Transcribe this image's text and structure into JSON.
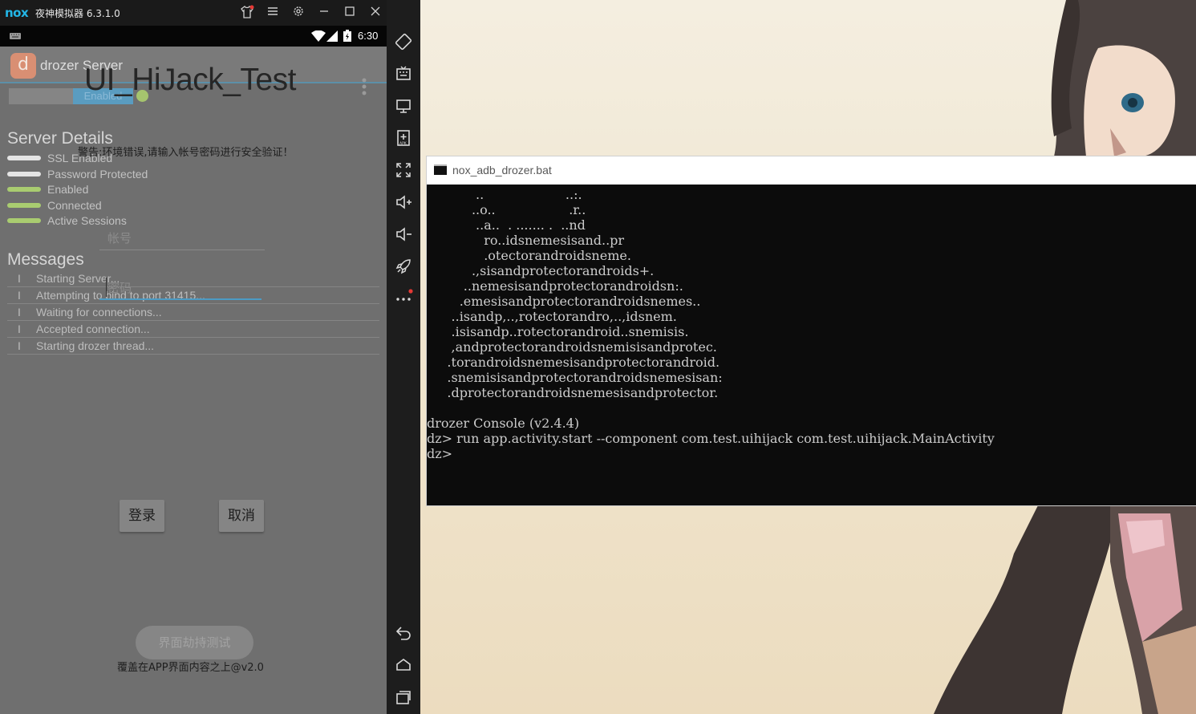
{
  "nox": {
    "logo": "nox",
    "title": "夜神模拟器 6.3.1.0",
    "accent": "#23b6e6"
  },
  "android": {
    "status_time": "6:30",
    "app_name": "drozer Server",
    "app_icon_letter": "d",
    "overlay_title": "UI_HiJack_Test",
    "enable_label": "Enabled",
    "server_details_heading": "Server Details",
    "warning_text": "警告:环境错误,请输入帐号密码进行安全验证！",
    "details": [
      {
        "label": "SSL Enabled",
        "color": "#e4e4e4"
      },
      {
        "label": "Password Protected",
        "color": "#e4e4e4"
      },
      {
        "label": "Enabled",
        "color": "#a9cc70"
      },
      {
        "label": "Connected",
        "color": "#a9cc70"
      },
      {
        "label": "Active Sessions",
        "color": "#a9cc70"
      }
    ],
    "username_placeholder": "帐号",
    "password_placeholder": "密码",
    "messages_heading": "Messages",
    "messages": [
      {
        "level": "I",
        "text": "Starting Server..."
      },
      {
        "level": "I",
        "text": "Attempting to bind to port 31415..."
      },
      {
        "level": "I",
        "text": "Waiting for connections..."
      },
      {
        "level": "I",
        "text": "Accepted connection..."
      },
      {
        "level": "I",
        "text": "Starting drozer thread..."
      }
    ],
    "login_button": "登录",
    "cancel_button": "取消",
    "hijack_button": "界面劫持测试",
    "footer_text": "覆盖在APP界面内容之上@v2.0"
  },
  "cmd": {
    "title": "nox_adb_drozer.bat",
    "lines": [
      "            ..                    ..:.",
      "           ..o..                  .r..",
      "            ..a..  . ....... .  ..nd",
      "              ro..idsnemesisand..pr",
      "              .otectorandroidsneme.",
      "           .,sisandprotectorandroids+.",
      "         ..nemesisandprotectorandroidsn:.",
      "        .emesisandprotectorandroidsnemes..",
      "      ..isandp,..,rotectorandro,..,idsnem.",
      "      .isisandp..rotectorandroid..snemisis.",
      "      ,andprotectorandroidsnemisisandprotec.",
      "     .torandroidsnemesisandprotectorandroid.",
      "     .snemisisandprotectorandroidsnemesisan:",
      "     .dprotectorandroidsnemesisandprotector.",
      "",
      "drozer Console (v2.4.4)",
      "dz> run app.activity.start --component com.test.uihijack com.test.uihijack.MainActivity",
      "dz>"
    ]
  }
}
